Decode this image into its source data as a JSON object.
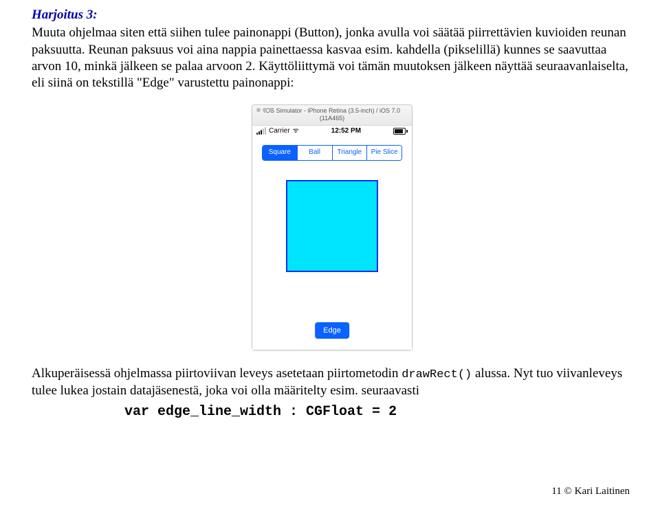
{
  "exercise_title": "Harjoitus 3:",
  "p1": "Muuta ohjelmaa siten että siihen tulee painonappi (Button), jonka avulla voi säätää piirrettävien kuvioiden reunan paksuutta. Reunan paksuus voi aina nappia painettaessa kasvaa esim. kahdella (pikselillä) kunnes se saavuttaa arvon 10, minkä jälkeen se palaa arvoon 2. Käyttöliittymä voi tämän muutoksen jälkeen näyttää seuraavanlaiselta, eli siinä on tekstillä \"Edge\" varustettu painonappi:",
  "simulator": {
    "window_title": "iOS Simulator - iPhone Retina (3.5-inch) / iOS 7.0 (11A465)",
    "carrier": "Carrier",
    "wifi_glyph": "ᯤ",
    "time": "12:52 PM",
    "segments": {
      "a": "Square",
      "b": "Ball",
      "c": "Triangle",
      "d": "Pie Slice"
    },
    "edge_button": "Edge"
  },
  "p2a": "Alkuperäisessä ohjelmassa piirtoviivan leveys asetetaan piirtometodin ",
  "p2b": "drawRect()",
  "p2c": " alussa. Nyt tuo viivanleveys tulee lukea jostain datajäsenestä, joka voi olla määritelty esim. seuraavasti",
  "code": "var edge_line_width : CGFloat = 2",
  "footer": "11 © Kari Laitinen"
}
